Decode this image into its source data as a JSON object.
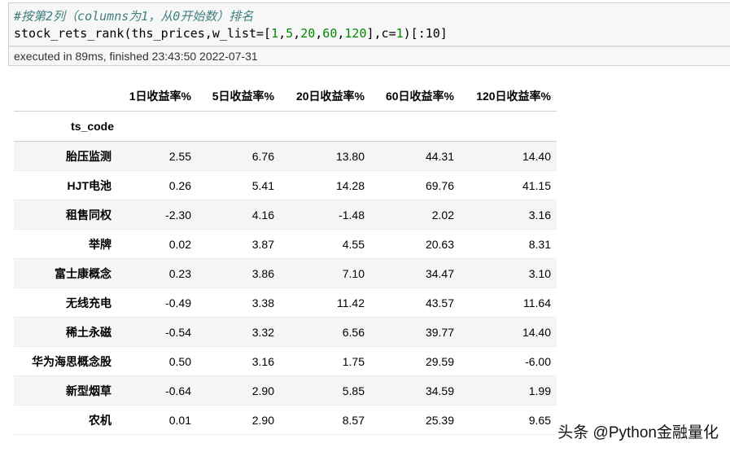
{
  "code": {
    "comment": "#按第2列（columns为1，从0开始数）排名",
    "line_func": "stock_rets_rank(ths_prices,w_list=[",
    "w_list": [
      "1",
      "5",
      "20",
      "60",
      "120"
    ],
    "line_mid": "],c=",
    "c_value": "1",
    "line_end": ")[:10]"
  },
  "execution": {
    "status": "executed in 89ms, finished 23:43:50 2022-07-31"
  },
  "table": {
    "columns": [
      "1日收益率%",
      "5日收益率%",
      "20日收益率%",
      "60日收益率%",
      "120日收益率%"
    ],
    "index_name": "ts_code",
    "rows": [
      {
        "name": "胎压监测",
        "values": [
          "2.55",
          "6.76",
          "13.80",
          "44.31",
          "14.40"
        ]
      },
      {
        "name": "HJT电池",
        "values": [
          "0.26",
          "5.41",
          "14.28",
          "69.76",
          "41.15"
        ]
      },
      {
        "name": "租售同权",
        "values": [
          "-2.30",
          "4.16",
          "-1.48",
          "2.02",
          "3.16"
        ]
      },
      {
        "name": "举牌",
        "values": [
          "0.02",
          "3.87",
          "4.55",
          "20.63",
          "8.31"
        ]
      },
      {
        "name": "富士康概念",
        "values": [
          "0.23",
          "3.86",
          "7.10",
          "34.47",
          "3.10"
        ]
      },
      {
        "name": "无线充电",
        "values": [
          "-0.49",
          "3.38",
          "11.42",
          "43.57",
          "11.64"
        ]
      },
      {
        "name": "稀土永磁",
        "values": [
          "-0.54",
          "3.32",
          "6.56",
          "39.77",
          "14.40"
        ]
      },
      {
        "name": "华为海思概念股",
        "values": [
          "0.50",
          "3.16",
          "1.75",
          "29.59",
          "-6.00"
        ]
      },
      {
        "name": "新型烟草",
        "values": [
          "-0.64",
          "2.90",
          "5.85",
          "34.59",
          "1.99"
        ]
      },
      {
        "name": "农机",
        "values": [
          "0.01",
          "2.90",
          "8.57",
          "25.39",
          "9.65"
        ]
      }
    ]
  },
  "watermark": "头条 @Python金融量化"
}
